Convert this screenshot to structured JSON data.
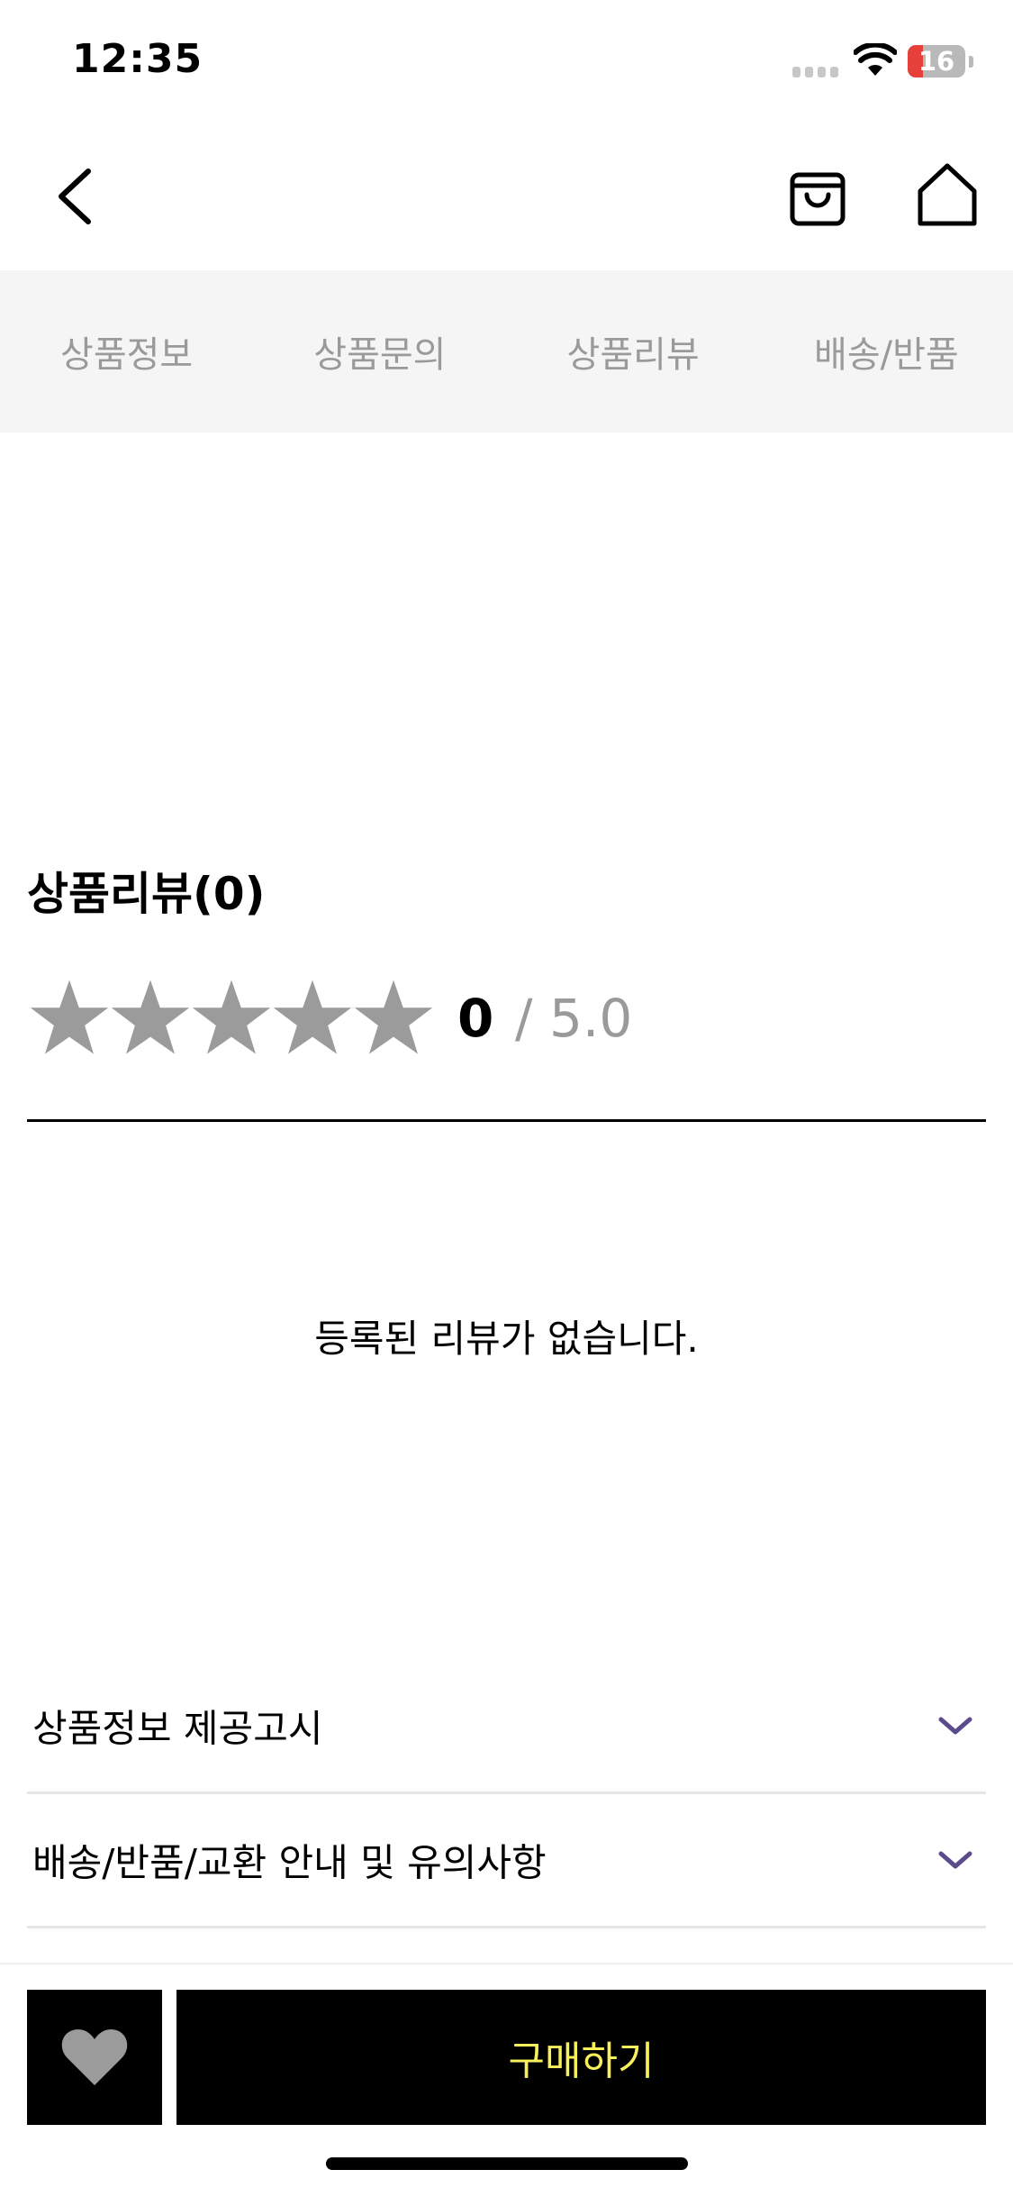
{
  "status_bar": {
    "time": "12:35",
    "battery_level": "16"
  },
  "header": {
    "back_icon": "chevron-left-icon",
    "cart_icon": "shopping-bag-icon",
    "home_icon": "home-icon"
  },
  "tabs": [
    {
      "label": "상품정보"
    },
    {
      "label": "상품문의"
    },
    {
      "label": "상품리뷰"
    },
    {
      "label": "배송/반품"
    }
  ],
  "review": {
    "title": "상품리뷰(0)",
    "rating": 0,
    "score": "0",
    "score_max": "/ 5.0",
    "empty_message": "등록된 리뷰가 없습니다.",
    "star_color": "#9b9b9b"
  },
  "accordions": [
    {
      "label": "상품정보 제공고시"
    },
    {
      "label": "배송/반품/교환 안내 및 유의사항"
    }
  ],
  "bottom_bar": {
    "like_icon": "heart-icon",
    "buy_label": "구매하기",
    "buy_text_color": "#f7f05a"
  },
  "colors": {
    "accent_chevron": "#5b4b8a",
    "tab_bg": "#f5f5f5"
  }
}
